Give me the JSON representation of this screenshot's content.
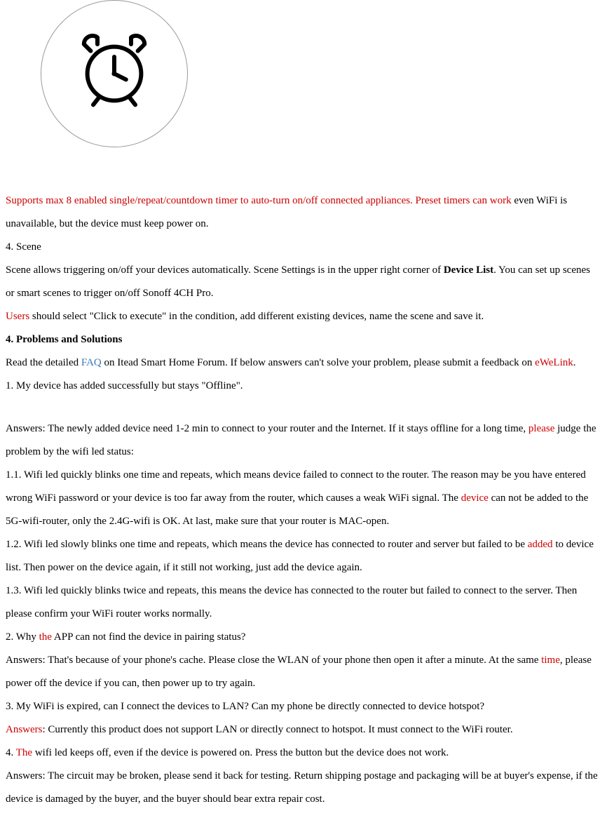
{
  "intro": {
    "red_supports": "Supports max 8 enabled single/repeat/countdown timer to auto-turn on/off connected appliances. Preset timers can work",
    "line_even": " even WiFi is unavailable, but the device must keep power on."
  },
  "scene": {
    "heading": "4. Scene",
    "p1_a": "Scene allows triggering on/off your devices automatically. Scene Settings is in the upper right corner of ",
    "device_list": "Device List",
    "p1_b": ". You can set up scenes or smart scenes to trigger on/off Sonoff 4CH Pro.",
    "users_red": "Users",
    "p2": " should select \"Click to execute\" in the condition, add different existing devices, name the scene and save it."
  },
  "problems": {
    "heading": "4. Problems and Solutions",
    "read_a": "Read the detailed ",
    "faq": "FAQ",
    "read_b": " on Itead Smart Home Forum. If below answers can't solve your problem, please submit a feedback on ",
    "ewelink": "eWeLink",
    "read_c": "."
  },
  "q1": {
    "question": "1. My device has added successfully but stays \"Offline\".",
    "ans_a": "Answers: The newly added device need 1-2 min to connect to your router and the Internet. If it stays offline for a long time, ",
    "please_red": "please",
    "ans_b": " judge the problem by the wifi led status:",
    "p11_a": "1.1. Wifi led quickly blinks one time and repeats, which means device failed to connect to the router. The reason may be you have entered wrong WiFi password or your device is too far away from the router, which causes a weak WiFi signal. The ",
    "device_red": "device",
    "p11_b": " can not be added to the 5G-wifi-router, only the 2.4G-wifi is OK. At last, make sure that your router is MAC-open.",
    "p12_a": "1.2. Wifi led slowly blinks one time and repeats, which means the device has connected to router and server but failed to be ",
    "added_red": "added",
    "p12_b": " to device list. Then power on the device again, if it still not working, just add the device again.",
    "p13": "1.3. Wifi led quickly blinks twice and repeats, this means the device has connected to the router but failed to connect to the server. Then please confirm your WiFi router works normally."
  },
  "q2": {
    "q_a": "2. Why ",
    "the_red": "the",
    "q_b": " APP can not find the device in pairing status?",
    "ans_a": "Answers: That's because of your phone's cache. Please close the WLAN of your phone then open it after a minute. At the same ",
    "time_red": "time",
    "ans_b": ", please power off the device if you can, then power up to try again."
  },
  "q3": {
    "question": "3. My WiFi is expired, can I connect the devices to LAN? Can my phone be directly connected to device hotspot?",
    "answers_red": "Answers",
    "ans_b": ": Currently this product does not support LAN or directly connect to hotspot. It must connect to the WiFi router."
  },
  "q4": {
    "q_a": "4. ",
    "the_red": "The",
    "q_b": " wifi led keeps off, even if the device is powered on. Press the button but the device does not work.",
    "answer": "Answers: The circuit may be broken, please send it back for testing. Return shipping postage and packaging will be at buyer's expense, if the device is damaged by the buyer, and the buyer should bear extra repair cost."
  }
}
